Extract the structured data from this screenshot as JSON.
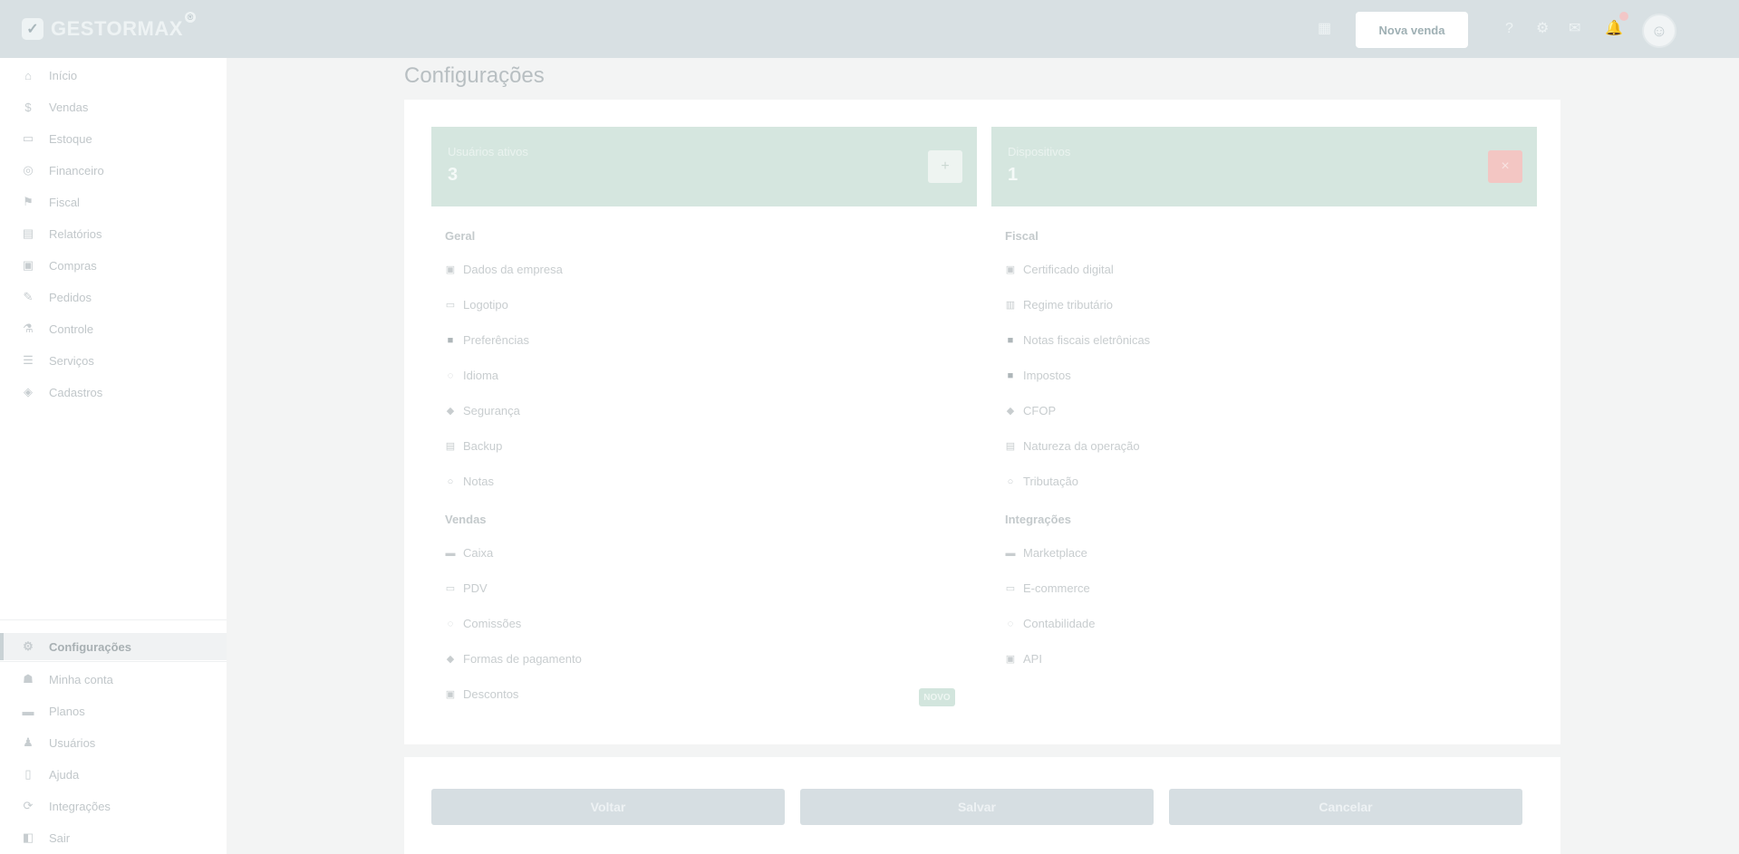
{
  "app": {
    "brand": "GESTORMAX",
    "brand_sup": "®",
    "logo_glyph": "✓"
  },
  "topbar": {
    "grid_icon": "▦",
    "cta_label": "Nova venda",
    "help_icon": "?",
    "settings_icon": "⚙",
    "chat_icon": "✉",
    "bell_icon": "🔔",
    "avatar_glyph": "☺"
  },
  "sidebar": {
    "items": [
      {
        "label": "Início",
        "icon": "⌂"
      },
      {
        "label": "Vendas",
        "icon": "$"
      },
      {
        "label": "Estoque",
        "icon": "▭"
      },
      {
        "label": "Financeiro",
        "icon": "◎"
      },
      {
        "label": "Fiscal",
        "icon": "⚑"
      },
      {
        "label": "Relatórios",
        "icon": "▤"
      },
      {
        "label": "Compras",
        "icon": "▣"
      },
      {
        "label": "Pedidos",
        "icon": "✎"
      },
      {
        "label": "Controle",
        "icon": "⚗"
      },
      {
        "label": "Serviços",
        "icon": "☰"
      },
      {
        "label": "Cadastros",
        "icon": "◈"
      }
    ],
    "active": {
      "label": "Configurações",
      "icon": "⚙"
    },
    "bottom_items": [
      {
        "label": "Minha conta",
        "icon": "☗"
      },
      {
        "label": "Planos",
        "icon": "▬"
      },
      {
        "label": "Usuários",
        "icon": "♟"
      },
      {
        "label": "Ajuda",
        "icon": "▯"
      },
      {
        "label": "Integrações",
        "icon": "⟳"
      },
      {
        "label": "Sair",
        "icon": "◧"
      }
    ]
  },
  "page": {
    "title": "Configurações"
  },
  "stats": [
    {
      "label": "Usuários ativos",
      "value": "3",
      "button_icon": "+",
      "button_color": "#eef4f1"
    },
    {
      "label": "Dispositivos",
      "value": "1",
      "button_icon": "×",
      "button_color": "#f3c6c3"
    }
  ],
  "left_sections": [
    {
      "title": "Geral",
      "items": [
        {
          "label": "Dados da empresa",
          "icon": "▣"
        },
        {
          "label": "Logotipo",
          "icon": "▭"
        },
        {
          "label": "Preferências",
          "icon": "■",
          "dark": true
        },
        {
          "label": "Idioma",
          "icon": "◌"
        },
        {
          "label": "Segurança",
          "icon": "◆"
        },
        {
          "label": "Backup",
          "icon": "▤"
        },
        {
          "label": "Notas",
          "icon": "○"
        }
      ]
    },
    {
      "title": "Vendas",
      "items": [
        {
          "label": "Caixa",
          "icon": "▬"
        },
        {
          "label": "PDV",
          "icon": "▭"
        },
        {
          "label": "Comissões",
          "icon": "◌"
        },
        {
          "label": "Formas de pagamento",
          "icon": "◆"
        },
        {
          "label": "Descontos",
          "icon": "▣"
        }
      ]
    }
  ],
  "right_sections": [
    {
      "title": "Fiscal",
      "items": [
        {
          "label": "Certificado digital",
          "icon": "▣"
        },
        {
          "label": "Regime tributário",
          "icon": "▥"
        },
        {
          "label": "Notas fiscais eletrônicas",
          "icon": "■",
          "dark": true
        },
        {
          "label": "Impostos",
          "icon": "■",
          "dark": true
        },
        {
          "label": "CFOP",
          "icon": "◆"
        },
        {
          "label": "Natureza da operação",
          "icon": "▤"
        },
        {
          "label": "Tributação",
          "icon": "○"
        }
      ]
    },
    {
      "title": "Integrações",
      "items": [
        {
          "label": "Marketplace",
          "icon": "▬"
        },
        {
          "label": "E-commerce",
          "icon": "▭"
        },
        {
          "label": "Contabilidade",
          "icon": "◌"
        },
        {
          "label": "API",
          "icon": "▣"
        }
      ]
    }
  ],
  "new_badge": "NOVO",
  "bottom_buttons": [
    {
      "label": "Voltar"
    },
    {
      "label": "Salvar"
    },
    {
      "label": "Cancelar"
    }
  ]
}
